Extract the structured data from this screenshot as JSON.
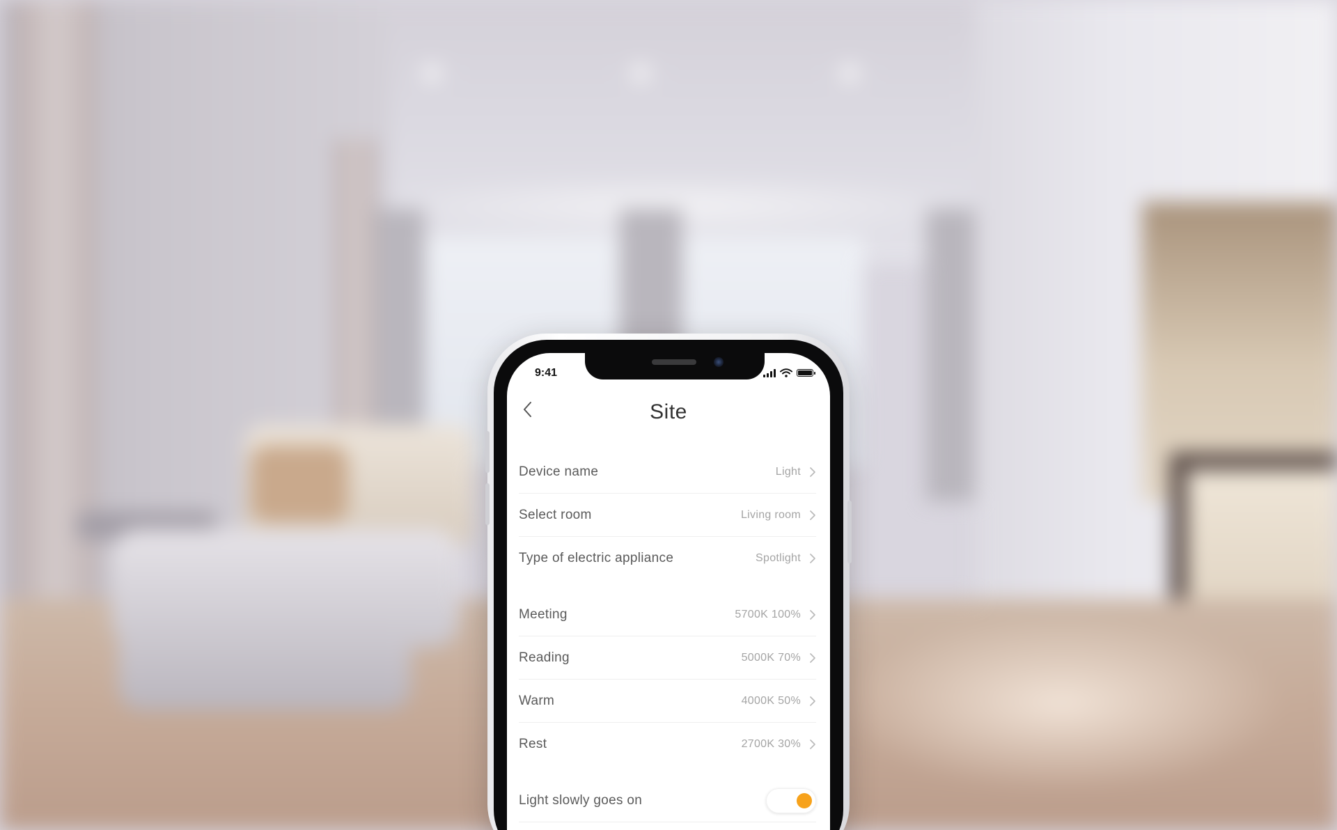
{
  "status_bar": {
    "time": "9:41",
    "icons": [
      "signal-icon",
      "wifi-icon",
      "battery-icon"
    ]
  },
  "header": {
    "title": "Site",
    "back_icon": "chevron-left-icon"
  },
  "device_settings": [
    {
      "label": "Device name",
      "value": "Light"
    },
    {
      "label": "Select room",
      "value": "Living room"
    },
    {
      "label": "Type of electric appliance",
      "value": "Spotlight"
    }
  ],
  "scenes": [
    {
      "label": "Meeting",
      "value": "5700K 100%"
    },
    {
      "label": "Reading",
      "value": "5000K 70%"
    },
    {
      "label": "Warm",
      "value": "4000K 50%"
    },
    {
      "label": "Rest",
      "value": "2700K 30%"
    }
  ],
  "options": {
    "slow_on": {
      "label": "Light slowly goes on",
      "enabled": true
    }
  },
  "colors": {
    "accent": "#f7a21b",
    "label": "#5a5a5a",
    "value": "#a4a4a4",
    "title": "#333333",
    "divider": "#efefef"
  }
}
